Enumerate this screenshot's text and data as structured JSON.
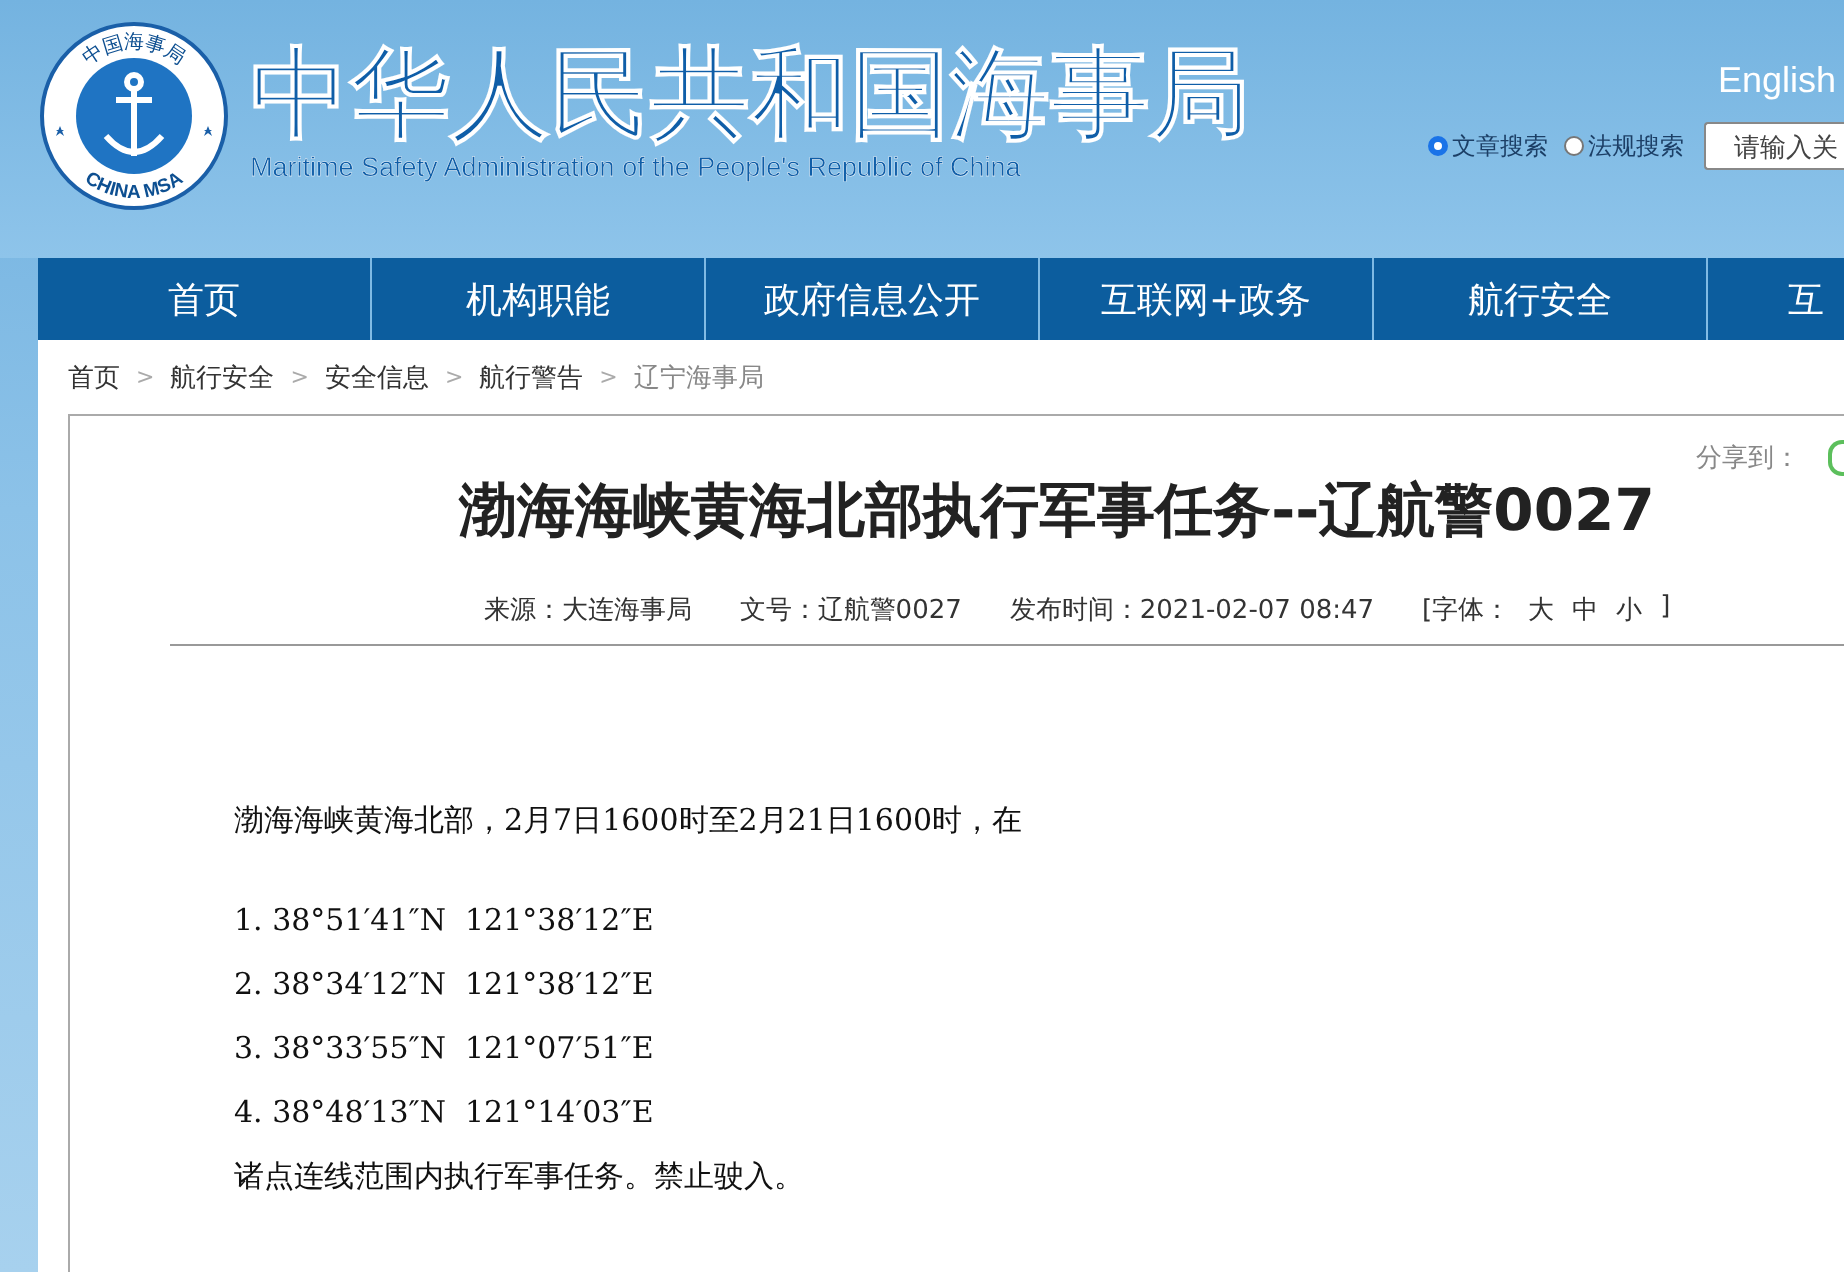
{
  "header": {
    "logo": {
      "arc_text": "中国海事局",
      "bottom_text": "CHINA MSA"
    },
    "title": "中华人民共和国海事局",
    "subtitle": "Maritime Safety Administration of the People's Republic of China",
    "language_link": "English",
    "search_options": [
      {
        "label": "文章搜索",
        "selected": true
      },
      {
        "label": "法规搜索",
        "selected": false
      }
    ],
    "search": {
      "placeholder": "请输入关"
    }
  },
  "nav": [
    {
      "label": "首页"
    },
    {
      "label": "机构职能"
    },
    {
      "label": "政府信息公开"
    },
    {
      "label": "互联网+政务"
    },
    {
      "label": "航行安全"
    },
    {
      "label": "互"
    }
  ],
  "breadcrumb": [
    {
      "label": "首页",
      "current": false
    },
    {
      "label": "航行安全",
      "current": false
    },
    {
      "label": "安全信息",
      "current": false
    },
    {
      "label": "航行警告",
      "current": false
    },
    {
      "label": "辽宁海事局",
      "current": true
    }
  ],
  "breadcrumb_separator": ">",
  "article": {
    "share_label": "分享到：",
    "title": "渤海海峡黄海北部执行军事任务--辽航警0027",
    "meta": [
      {
        "kind": "text",
        "text": "来源：大连海事局"
      },
      {
        "kind": "text",
        "text": "文号：辽航警0027"
      },
      {
        "kind": "text",
        "text": "发布时间：2021-02-07 08:47"
      },
      {
        "kind": "font",
        "label": "[字体：",
        "sizes": [
          "大",
          "中",
          "小"
        ],
        "close": "]"
      }
    ],
    "intro": "渤海海峡黄海北部，2月7日1600时至2月21日1600时，在",
    "points": [
      "1. 38°51′41″N  121°38′12″E",
      "2. 38°34′12″N  121°38′12″E",
      "3. 38°33′55″N  121°07′51″E",
      "4. 38°48′13″N  121°14′03″E"
    ],
    "closing": "诸点连线范围内执行军事任务。禁止驶入。"
  }
}
